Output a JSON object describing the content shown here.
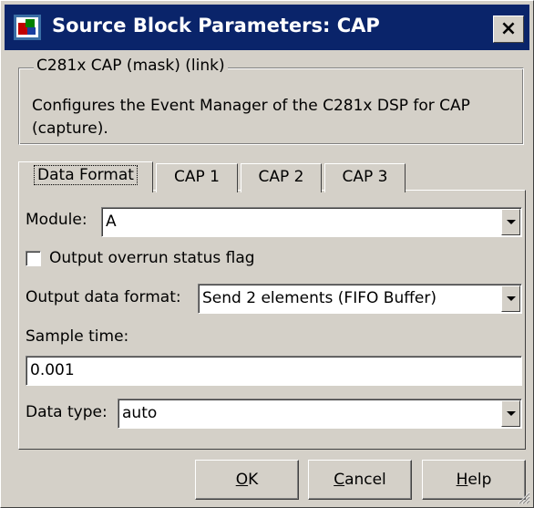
{
  "window": {
    "title": "Source Block Parameters: CAP",
    "close_glyph": "×"
  },
  "group": {
    "title": "C281x CAP (mask) (link)",
    "description": "Configures the Event Manager of the C281x DSP for CAP (capture)."
  },
  "tabs": [
    {
      "label": "Data Format",
      "active": true
    },
    {
      "label": "CAP 1",
      "active": false
    },
    {
      "label": "CAP 2",
      "active": false
    },
    {
      "label": "CAP 3",
      "active": false
    }
  ],
  "fields": {
    "module": {
      "label": "Module:",
      "value": "A"
    },
    "overrun": {
      "label": "Output overrun status flag",
      "checked": false
    },
    "output_format": {
      "label": "Output data format:",
      "value": "Send 2 elements (FIFO Buffer)"
    },
    "sample_time": {
      "label": "Sample time:",
      "value": "0.001"
    },
    "data_type": {
      "label": "Data type:",
      "value": "auto"
    }
  },
  "buttons": {
    "ok": {
      "mnemonic": "O",
      "rest": "K"
    },
    "cancel": {
      "mnemonic": "C",
      "rest": "ancel"
    },
    "help": {
      "mnemonic": "H",
      "rest": "elp"
    }
  },
  "colors": {
    "titlebar": "#0a246a",
    "face": "#d4d0c8"
  }
}
